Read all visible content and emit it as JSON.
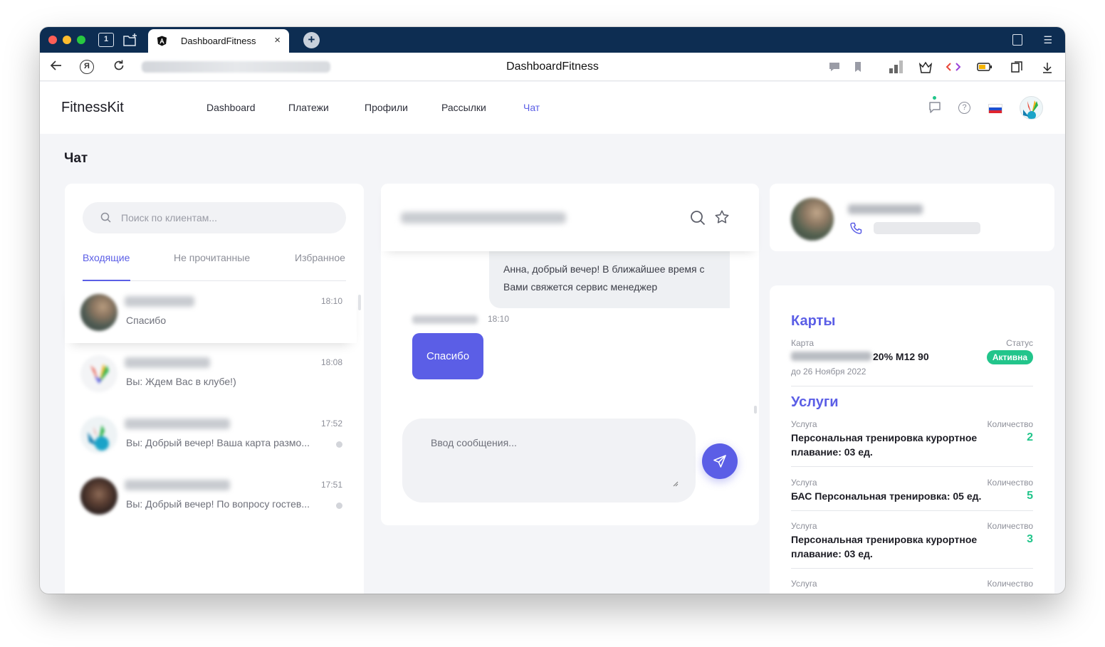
{
  "browser": {
    "tab_title": "DashboardFitness",
    "page_title": "DashboardFitness",
    "home_badge": "1",
    "close_glyph": "×",
    "new_tab_glyph": "+"
  },
  "header": {
    "brand": "FitnessKit",
    "nav": [
      "Dashboard",
      "Платежи",
      "Профили",
      "Рассылки",
      "Чат"
    ],
    "help_glyph": "?"
  },
  "page": {
    "title": "Чат"
  },
  "clients_panel": {
    "search_placeholder": "Поиск по клиентам...",
    "tabs": [
      "Входящие",
      "Не прочитанные",
      "Избранное"
    ],
    "clients": [
      {
        "time": "18:10",
        "message": "Спасибо"
      },
      {
        "time": "18:08",
        "message": "Вы: Ждем Вас в клубе!)"
      },
      {
        "time": "17:52",
        "message": "Вы: Добрый вечер! Ваша карта размо..."
      },
      {
        "time": "17:51",
        "message": "Вы: Добрый вечер! По вопросу гостев..."
      }
    ]
  },
  "chat": {
    "incoming_message": "Анна, добрый вечер! В ближайшее время с Вами свяжется сервис менеджер",
    "sent_time": "18:10",
    "outgoing_message": "Спасибо",
    "composer_placeholder": "Ввод сообщения..."
  },
  "info": {
    "cards_title": "Карты",
    "card_label": "Карта",
    "status_label": "Статус",
    "card_name": "20% М12 90",
    "card_valid": "до 26 Ноября 2022",
    "card_status": "Активна",
    "services_title": "Услуги",
    "service_label": "Услуга",
    "qty_label": "Количество",
    "services": [
      {
        "name": "Персональная тренировка курортное плавание: 03 ед.",
        "qty": "2"
      },
      {
        "name": "БАС Персональная тренировка: 05 ед.",
        "qty": "5"
      },
      {
        "name": "Персональная тренировка курортное плавание: 03 ед.",
        "qty": "3"
      }
    ]
  },
  "colors": {
    "accent": "#5b5ee6",
    "success": "#22c58b",
    "browser_chrome": "#0d2d52"
  },
  "icons": [
    "search-icon",
    "star-icon",
    "send-icon",
    "phone-icon",
    "chat-icon",
    "help-icon",
    "flag-ru-icon",
    "back-icon",
    "reload-icon",
    "download-icon"
  ]
}
